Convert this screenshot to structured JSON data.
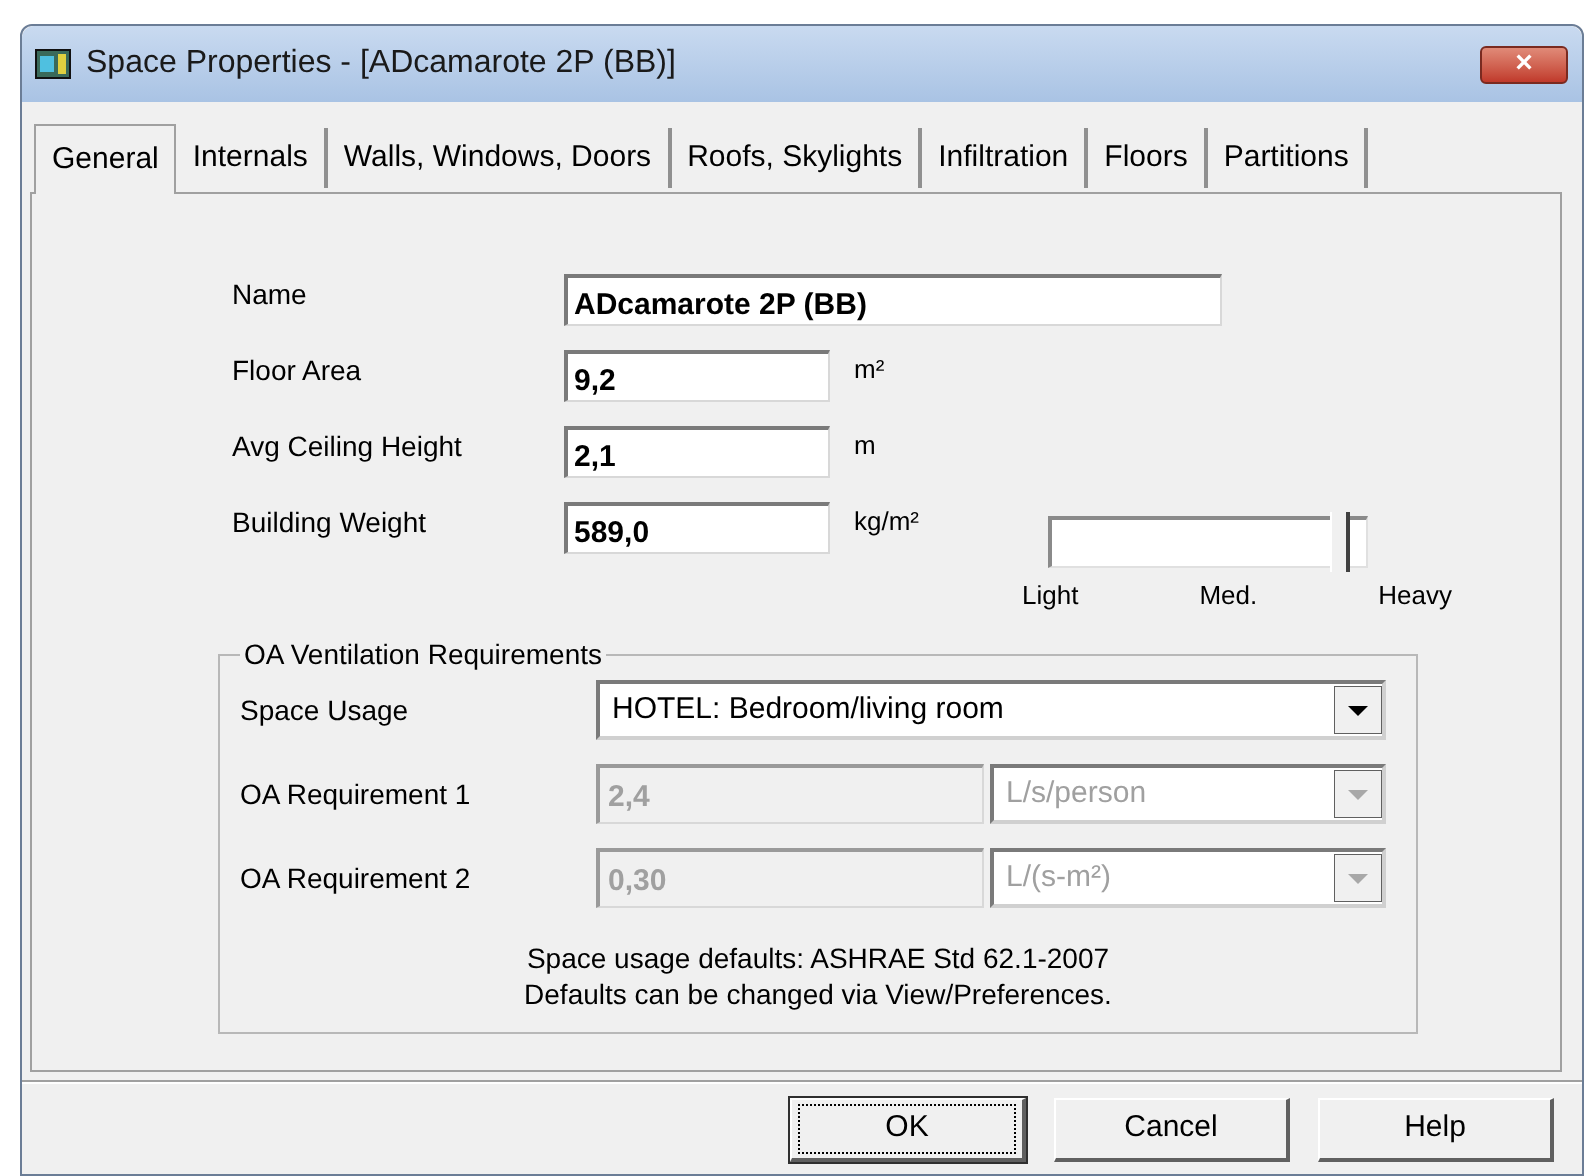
{
  "window": {
    "title": "Space Properties - [ADcamarote 2P (BB)]",
    "close": "×"
  },
  "tabs": [
    {
      "label": "General",
      "selected": true
    },
    {
      "label": "Internals",
      "selected": false
    },
    {
      "label": "Walls, Windows, Doors",
      "selected": false
    },
    {
      "label": "Roofs, Skylights",
      "selected": false
    },
    {
      "label": "Infiltration",
      "selected": false
    },
    {
      "label": "Floors",
      "selected": false
    },
    {
      "label": "Partitions",
      "selected": false
    }
  ],
  "fields": [
    {
      "label": "Name",
      "value": "ADcamarote 2P (BB)",
      "kind": "wide"
    },
    {
      "label": "Floor Area",
      "value": "9,2",
      "unit": "m²",
      "kind": "short"
    },
    {
      "label": "Avg Ceiling Height",
      "value": "2,1",
      "unit": "m",
      "kind": "short"
    },
    {
      "label": "Building Weight",
      "value": "589,0",
      "unit": "kg/m²",
      "kind": "short"
    }
  ],
  "weight_slider": {
    "level": 0.95,
    "labels": [
      "Light",
      "Med.",
      "Heavy"
    ]
  },
  "ventilation": {
    "title": "OA Ventilation Requirements",
    "rows": [
      {
        "label": "Space Usage",
        "kind": "select",
        "value": "HOTEL: Bedroom/living room",
        "disabled": false
      },
      {
        "label": "OA Requirement 1",
        "kind": "value_unit",
        "value": "2,4",
        "unit": "L/s/person",
        "disabled": true
      },
      {
        "label": "OA Requirement 2",
        "kind": "value_unit",
        "value": "0,30",
        "unit": "L/(s-m²)",
        "disabled": true
      }
    ],
    "notes": [
      "Space usage defaults: ASHRAE Std 62.1-2007",
      "Defaults can be changed via View/Preferences."
    ]
  },
  "buttons": [
    {
      "label": "OK",
      "default": true
    },
    {
      "label": "Cancel",
      "default": false
    },
    {
      "label": "Help",
      "default": false
    }
  ]
}
